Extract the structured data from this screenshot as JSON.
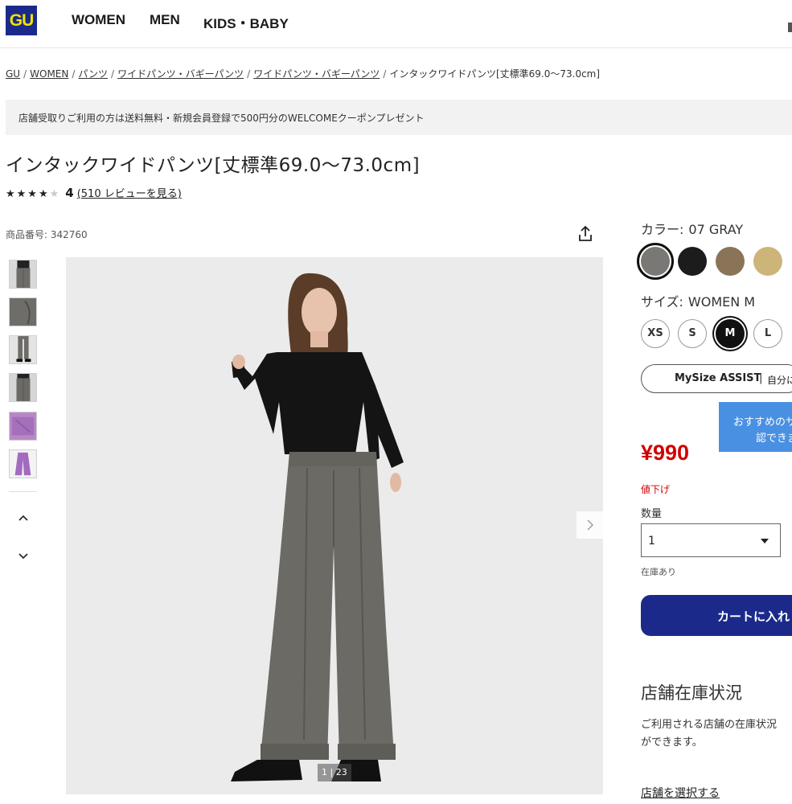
{
  "header": {
    "logo_text": "GU",
    "nav": [
      "WOMEN",
      "MEN",
      "KIDS・BABY"
    ]
  },
  "breadcrumb": [
    "GU",
    "WOMEN",
    "パンツ",
    "ワイドパンツ・バギーパンツ",
    "ワイドパンツ・バギーパンツ",
    "インタックワイドパンツ[丈標準69.0〜73.0cm]"
  ],
  "banner": {
    "text": "店舗受取りご利用の方は送料無料・新規会員登録で500円分のWELCOMEクーポンプレゼント"
  },
  "product": {
    "title": "インタックワイドパンツ[丈標準69.0〜73.0cm]",
    "rating_stars_filled": 4,
    "rating_value": "4",
    "review_link": "(510 レビューを見る)",
    "product_number": "商品番号: 342760"
  },
  "gallery": {
    "thumbnail_count": 6,
    "counter": "1 | 23"
  },
  "color": {
    "label": "カラー:",
    "selected": "07 GRAY",
    "swatches": [
      "#7a7875",
      "#1c1c1c",
      "#8a7458",
      "#cdb478"
    ]
  },
  "size": {
    "label": "サイズ:",
    "selected": "WOMEN M",
    "options": [
      "XS",
      "S",
      "M",
      "L"
    ]
  },
  "mysize": {
    "brand": "MySize ASSIST",
    "divider": "|",
    "text": "自分に"
  },
  "recommend": {
    "line1": "おすすめのサ",
    "line2": "認できま"
  },
  "price": {
    "value": "¥990",
    "discount_label": "値下げ"
  },
  "quantity": {
    "label": "数量",
    "value": "1",
    "stock": "在庫あり"
  },
  "cart": {
    "button_label": "カートに入れ"
  },
  "store": {
    "heading": "店舗在庫状況",
    "text_line1": "ご利用される店舗の在庫状況",
    "text_line2": "ができます。",
    "select_link": "店舗を選択する"
  },
  "colors": {
    "brand_navy": "#1b2a8a",
    "logo_yellow": "#f2e200",
    "price_red": "#d20000",
    "reco_blue": "#4a90e2"
  }
}
